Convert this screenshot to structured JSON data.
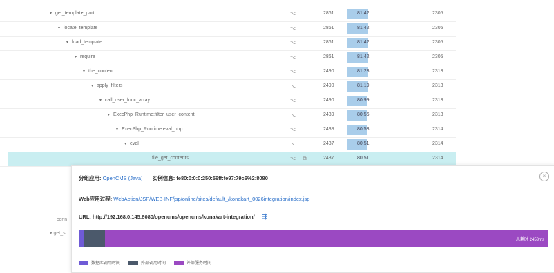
{
  "tree": {
    "rows": [
      {
        "label": "get_template_part",
        "indent": 1,
        "c1": "2861",
        "pct": "81.42",
        "c3": "2305"
      },
      {
        "label": "locate_template",
        "indent": 2,
        "c1": "2861",
        "pct": "81.42",
        "c3": "2305"
      },
      {
        "label": "load_template",
        "indent": 3,
        "c1": "2861",
        "pct": "81.42",
        "c3": "2305"
      },
      {
        "label": "require",
        "indent": 4,
        "c1": "2861",
        "pct": "81.42",
        "c3": "2305"
      },
      {
        "label": "the_content",
        "indent": 5,
        "c1": "2490",
        "pct": "81.23",
        "c3": "2313"
      },
      {
        "label": "apply_filters",
        "indent": 6,
        "c1": "2490",
        "pct": "81.19",
        "c3": "2313"
      },
      {
        "label": "call_user_func_array",
        "indent": 7,
        "c1": "2490",
        "pct": "80.99",
        "c3": "2313"
      },
      {
        "label": "ExecPhp_Runtime:filter_user_content",
        "indent": 8,
        "c1": "2439",
        "pct": "80.56",
        "c3": "2313"
      },
      {
        "label": "ExecPhp_Runtime:eval_php",
        "indent": 9,
        "c1": "2438",
        "pct": "80.53",
        "c3": "2314"
      },
      {
        "label": "eval",
        "indent": 10,
        "c1": "2437",
        "pct": "80.51",
        "c3": "2314"
      },
      {
        "label": "file_get_contents",
        "indent": 11,
        "c1": "2437",
        "pct": "80.51",
        "c3": "2314"
      }
    ],
    "below": {
      "leftA": "conn",
      "leftB": "get_s"
    }
  },
  "popup": {
    "app_label": "分组应用:",
    "app_value": "OpenCMS (Java)",
    "inst_label": "实例信息:",
    "inst_value": "fe80:0:0:0:250:56ff:fe97:79c6%2:8080",
    "web_label": "Web应用过程:",
    "web_value": "WebAction/JSP/WEB-INF/jsp/online/sites/default_/konakart_0026integration/index.jsp",
    "url_label": "URL:",
    "url_value": "http://192.168.0.145:8080/opencms/opencms/konakart-integration/",
    "timeline": {
      "label": "总耗时 2453ms",
      "segments": [
        {
          "name": "数据库调用时间",
          "fraction": 0.011
        },
        {
          "name": "外部调用时间",
          "fraction": 0.046
        },
        {
          "name": "外部服务时间",
          "fraction": 0.943
        }
      ]
    },
    "legend": [
      {
        "label": "数据库调用时间",
        "color": "#6f5bd6"
      },
      {
        "label": "外部调用时间",
        "color": "#4b596b"
      },
      {
        "label": "外部服务时间",
        "color": "#9b49c2"
      }
    ],
    "colors": {
      "link": "#2a6fc9",
      "row_selected": "#c9eef1",
      "bar_fill": "#a9cdea"
    }
  }
}
